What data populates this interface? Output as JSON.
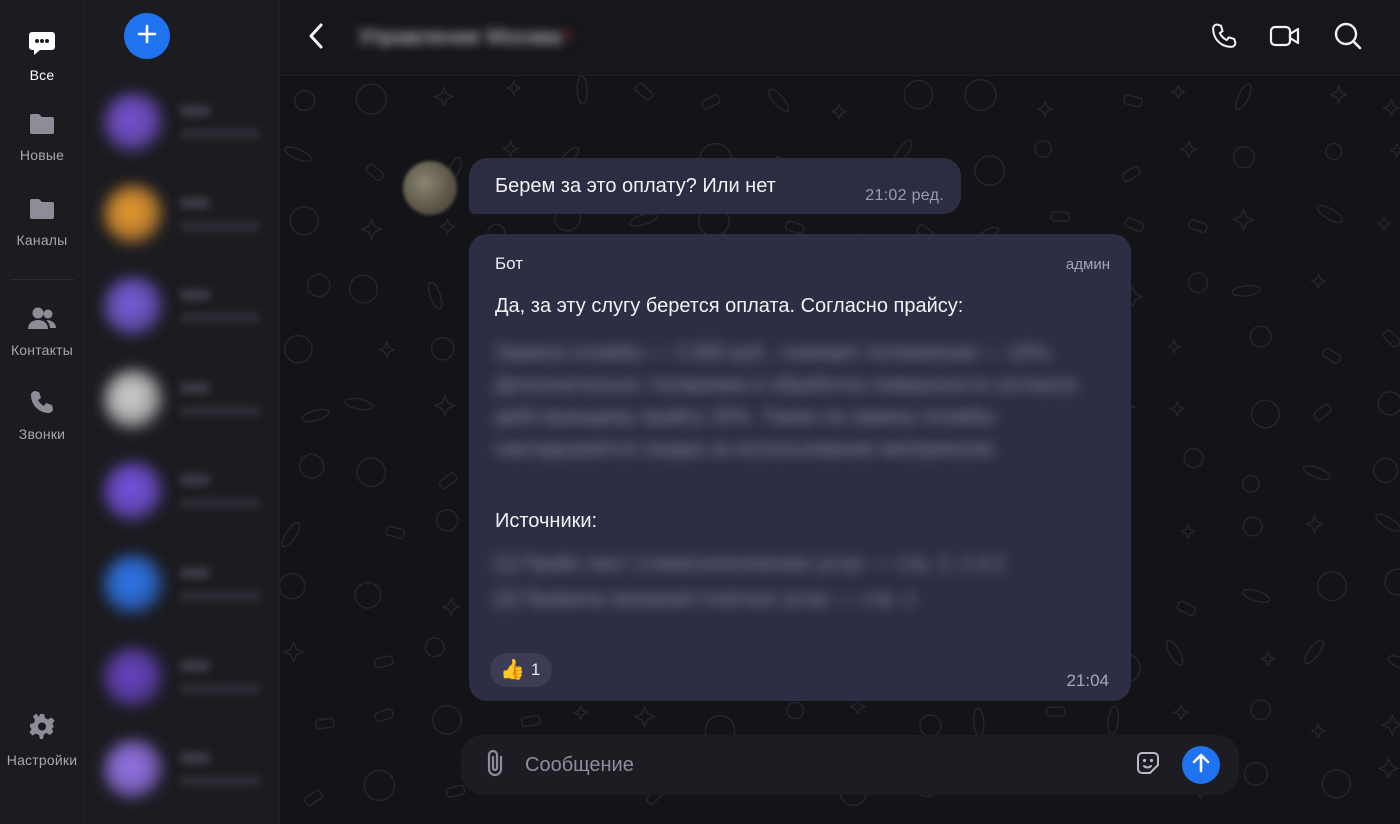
{
  "rail": {
    "items": [
      {
        "label": "Все",
        "icon": "chat-bubble-icon",
        "active": true
      },
      {
        "label": "Новые",
        "icon": "folder-icon"
      },
      {
        "label": "Каналы",
        "icon": "folder-icon"
      },
      {
        "label": "Контакты",
        "icon": "contacts-icon"
      },
      {
        "label": "Звонки",
        "icon": "phone-icon"
      },
      {
        "label": "Настройки",
        "icon": "gear-icon"
      }
    ]
  },
  "chatlist": {
    "compose_icon": "plus-icon",
    "accent": "#1f73f0",
    "avatar_colors": [
      "#7a55d9",
      "#f0a030",
      "#7b5fe0",
      "#d9d9d9",
      "#7a55e8",
      "#2f7af5",
      "#6a45c8",
      "#9a78f0"
    ]
  },
  "header": {
    "title": "Управление Москва",
    "title_mark": "!",
    "icons": [
      "back-icon",
      "phone-icon",
      "video-icon",
      "search-icon"
    ]
  },
  "messages": {
    "m1": {
      "text": "Берем за это оплату? Или нет",
      "time": "21:02 ред."
    },
    "m2": {
      "sender": "Бот",
      "role": "админ",
      "intro": "Да, за эту слугу берется оплата. Согласно прайсу:",
      "body_lines": [
        "Замена пломбы — 3 000 руб., снимают потемнение — 10%.",
        "Дополнительно: полировка и обработка поверхности согласно",
        "действующему прайсу 20%. Также на замену пломбы",
        "накладывается скидка за использование материалов."
      ],
      "sources_label": "Источники:",
      "source_lines": [
        "[1] Прайс-лист стоматологических услуг — стр. 2, п.4.2",
        "[2] Правила оказания платных услуг — стр. 1"
      ],
      "reaction_emoji": "👍",
      "reaction_count": "1",
      "time": "21:04"
    }
  },
  "composer": {
    "placeholder": "Сообщение",
    "icons": [
      "paperclip-icon",
      "sticker-icon",
      "send-arrow-icon"
    ]
  }
}
